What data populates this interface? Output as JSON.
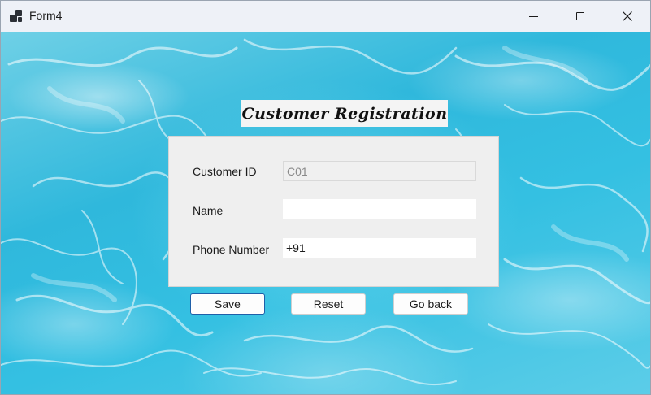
{
  "window": {
    "title": "Form4",
    "icon": "app-window-icon",
    "controls": {
      "minimize": "minimize-icon",
      "maximize": "maximize-icon",
      "close": "close-icon"
    }
  },
  "form": {
    "heading": "Customer Registration",
    "fields": {
      "customer_id": {
        "label": "Customer ID",
        "value": "C01",
        "enabled": false
      },
      "name": {
        "label": "Name",
        "value": "",
        "enabled": true
      },
      "phone": {
        "label": "Phone Number",
        "value": "+91",
        "enabled": true
      }
    },
    "buttons": {
      "save": "Save",
      "reset": "Reset",
      "go_back": "Go back"
    }
  },
  "colors": {
    "water_accent": "#2fb8dc",
    "panel_bg": "#efefef",
    "focus_border": "#1f5fa8"
  }
}
